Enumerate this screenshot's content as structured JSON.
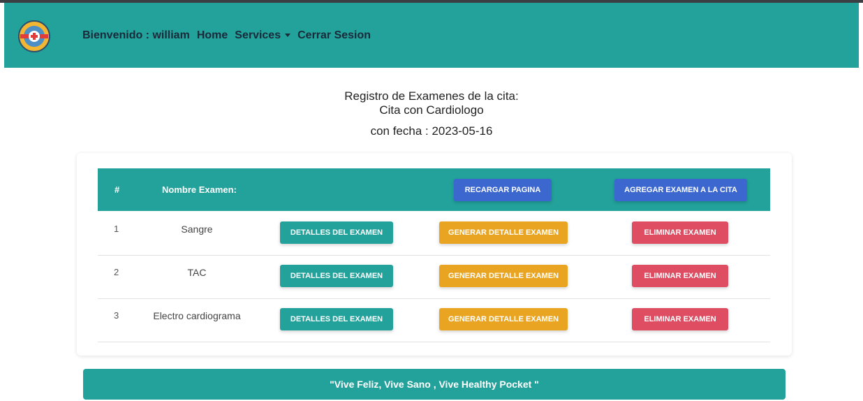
{
  "navbar": {
    "welcome": "Bienvenido : william",
    "home": "Home",
    "services": "Services",
    "logout": "Cerrar Sesion"
  },
  "heading": {
    "line1": "Registro de Examenes de la cita:",
    "line2": "Cita con Cardiologo",
    "line3": "con fecha : 2023-05-16"
  },
  "table": {
    "col_num": "#",
    "col_name": "Nombre Examen:",
    "reload_button": "RECARGAR PAGINA",
    "add_button": "AGREGAR EXAMEN A LA CITA",
    "rows": [
      {
        "num": "1",
        "name": "Sangre",
        "details": "DETALLES DEL EXAMEN",
        "generate": "GENERAR DETALLE EXAMEN",
        "delete": "ELIMINAR EXAMEN"
      },
      {
        "num": "2",
        "name": "TAC",
        "details": "DETALLES DEL EXAMEN",
        "generate": "GENERAR DETALLE EXAMEN",
        "delete": "ELIMINAR EXAMEN"
      },
      {
        "num": "3",
        "name": "Electro cardiograma",
        "details": "DETALLES DEL EXAMEN",
        "generate": "GENERAR DETALLE EXAMEN",
        "delete": "ELIMINAR EXAMEN"
      }
    ]
  },
  "footer": {
    "slogan": "\"Vive Feliz, Vive Sano , Vive Healthy Pocket \""
  },
  "colors": {
    "primary": "#22a29b",
    "blue": "#3b67cf",
    "orange": "#e9a521",
    "red": "#de4d62"
  },
  "icons": {
    "logo": "medical-cross-logo-icon",
    "services_caret": "caret-down-icon"
  }
}
